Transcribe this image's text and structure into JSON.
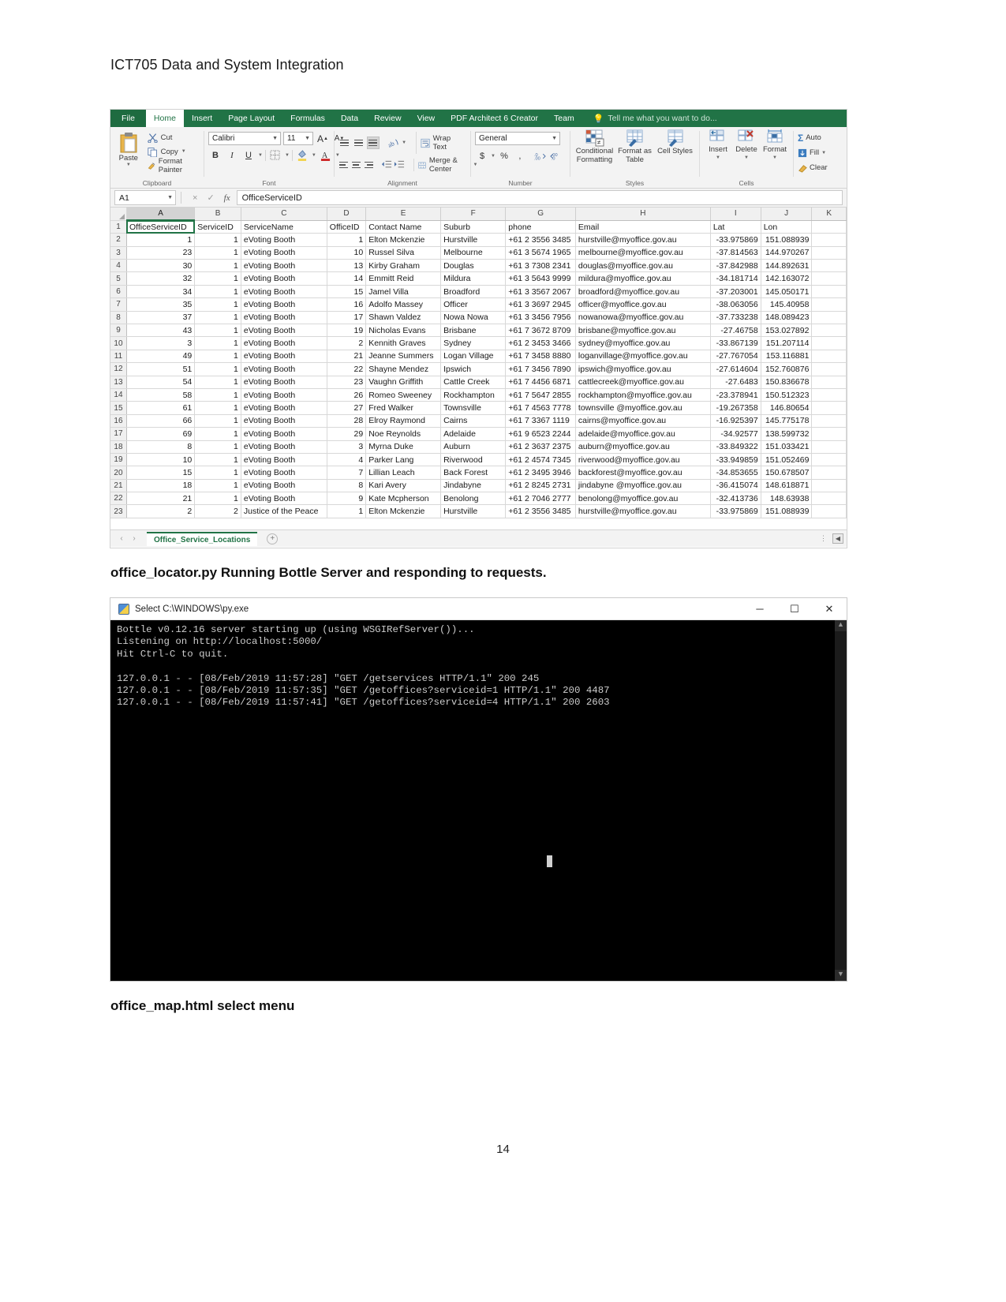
{
  "document": {
    "title": "ICT705 Data and System Integration",
    "page_number": "14",
    "caption_1": "office_locator.py Running Bottle Server and responding to requests.",
    "caption_2": "office_map.html select menu"
  },
  "excel": {
    "tabs": [
      {
        "label": "File",
        "state": "file"
      },
      {
        "label": "Home",
        "state": "active"
      },
      {
        "label": "Insert",
        "state": "normal"
      },
      {
        "label": "Page Layout",
        "state": "normal"
      },
      {
        "label": "Formulas",
        "state": "normal"
      },
      {
        "label": "Data",
        "state": "normal"
      },
      {
        "label": "Review",
        "state": "normal"
      },
      {
        "label": "View",
        "state": "normal"
      },
      {
        "label": "PDF Architect 6 Creator",
        "state": "normal"
      },
      {
        "label": "Team",
        "state": "normal"
      }
    ],
    "tell_me": "Tell me what you want to do...",
    "ribbon": {
      "clipboard": {
        "group_label": "Clipboard",
        "paste": "Paste",
        "cut": "Cut",
        "copy": "Copy",
        "format_painter": "Format Painter"
      },
      "font": {
        "group_label": "Font",
        "font_name": "Calibri",
        "font_size": "11",
        "grow_font": "A",
        "shrink_font": "A",
        "bold": "B",
        "italic": "I",
        "underline": "U"
      },
      "alignment": {
        "group_label": "Alignment",
        "wrap_text": "Wrap Text",
        "merge_center": "Merge & Center"
      },
      "number": {
        "group_label": "Number",
        "format": "General",
        "currency": "$",
        "percent": "%",
        "comma": ","
      },
      "styles": {
        "group_label": "Styles",
        "conditional_formatting": "Conditional Formatting",
        "format_as_table": "Format as Table",
        "cell_styles": "Cell Styles"
      },
      "cells": {
        "group_label": "Cells",
        "insert": "Insert",
        "delete": "Delete",
        "format": "Format"
      },
      "editing": {
        "autosum": "Auto",
        "fill": "Fill",
        "clear": "Clear"
      }
    },
    "formula_bar": {
      "name_box": "A1",
      "cancel": "×",
      "confirm": "✓",
      "fx": "fx",
      "value": "OfficeServiceID"
    },
    "grid": {
      "column_letters": [
        "A",
        "B",
        "C",
        "D",
        "E",
        "F",
        "G",
        "H",
        "I",
        "J",
        "K"
      ],
      "row_numbers": [
        "1",
        "2",
        "3",
        "4",
        "5",
        "6",
        "7",
        "8",
        "9",
        "10",
        "11",
        "12",
        "13",
        "14",
        "15",
        "16",
        "17",
        "18",
        "19",
        "20",
        "21",
        "22",
        "23"
      ],
      "headers": [
        "OfficeServiceID",
        "ServiceID",
        "ServiceName",
        "OfficeID",
        "Contact Name",
        "Suburb",
        "phone",
        "Email",
        "Lat",
        "Lon",
        ""
      ],
      "rows": [
        [
          "1",
          "1",
          "eVoting Booth",
          "1",
          "Elton Mckenzie",
          "Hurstville",
          "+61 2 3556 3485",
          "hurstville@myoffice.gov.au",
          "-33.975869",
          "151.088939",
          ""
        ],
        [
          "23",
          "1",
          "eVoting Booth",
          "10",
          "Russel Silva",
          "Melbourne",
          "+61 3 5674 1965",
          "melbourne@myoffice.gov.au",
          "-37.814563",
          "144.970267",
          ""
        ],
        [
          "30",
          "1",
          "eVoting Booth",
          "13",
          "Kirby Graham",
          "Douglas",
          "+61 3 7308 2341",
          "douglas@myoffice.gov.au",
          "-37.842988",
          "144.892631",
          ""
        ],
        [
          "32",
          "1",
          "eVoting Booth",
          "14",
          "Emmitt Reid",
          "Mildura",
          "+61 3 5643 9999",
          "mildura@myoffice.gov.au",
          "-34.181714",
          "142.163072",
          ""
        ],
        [
          "34",
          "1",
          "eVoting Booth",
          "15",
          "Jamel Villa",
          "Broadford",
          "+61 3 3567 2067",
          "broadford@myoffice.gov.au",
          "-37.203001",
          "145.050171",
          ""
        ],
        [
          "35",
          "1",
          "eVoting Booth",
          "16",
          "Adolfo Massey",
          "Officer",
          "+61 3 3697 2945",
          "officer@myoffice.gov.au",
          "-38.063056",
          "145.40958",
          ""
        ],
        [
          "37",
          "1",
          "eVoting Booth",
          "17",
          "Shawn Valdez",
          "Nowa Nowa",
          "+61 3 3456 7956",
          "nowanowa@myoffice.gov.au",
          "-37.733238",
          "148.089423",
          ""
        ],
        [
          "43",
          "1",
          "eVoting Booth",
          "19",
          "Nicholas Evans",
          "Brisbane",
          "+61 7 3672 8709",
          "brisbane@myoffice.gov.au",
          "-27.46758",
          "153.027892",
          ""
        ],
        [
          "3",
          "1",
          "eVoting Booth",
          "2",
          "Kennith Graves",
          "Sydney",
          "+61 2 3453 3466",
          "sydney@myoffice.gov.au",
          "-33.867139",
          "151.207114",
          ""
        ],
        [
          "49",
          "1",
          "eVoting Booth",
          "21",
          "Jeanne Summers",
          "Logan Village",
          "+61 7 3458 8880",
          "loganvillage@myoffice.gov.au",
          "-27.767054",
          "153.116881",
          ""
        ],
        [
          "51",
          "1",
          "eVoting Booth",
          "22",
          "Shayne Mendez",
          "Ipswich",
          "+61 7 3456 7890",
          "ipswich@myoffice.gov.au",
          "-27.614604",
          "152.760876",
          ""
        ],
        [
          "54",
          "1",
          "eVoting Booth",
          "23",
          "Vaughn Griffith",
          "Cattle Creek",
          "+61 7 4456 6871",
          "cattlecreek@myoffice.gov.au",
          "-27.6483",
          "150.836678",
          ""
        ],
        [
          "58",
          "1",
          "eVoting Booth",
          "26",
          "Romeo Sweeney",
          "Rockhampton",
          "+61 7 5647 2855",
          "rockhampton@myoffice.gov.au",
          "-23.378941",
          "150.512323",
          ""
        ],
        [
          "61",
          "1",
          "eVoting Booth",
          "27",
          "Fred Walker",
          "Townsville",
          "+61 7 4563 7778",
          "townsville @myoffice.gov.au",
          "-19.267358",
          "146.80654",
          ""
        ],
        [
          "66",
          "1",
          "eVoting Booth",
          "28",
          "Elroy Raymond",
          "Cairns",
          "+61 7 3367 1119",
          "cairns@myoffice.gov.au",
          "-16.925397",
          "145.775178",
          ""
        ],
        [
          "69",
          "1",
          "eVoting Booth",
          "29",
          "Noe Reynolds",
          "Adelaide",
          "+61 9 6523 2244",
          "adelaide@myoffice.gov.au",
          "-34.92577",
          "138.599732",
          ""
        ],
        [
          "8",
          "1",
          "eVoting Booth",
          "3",
          "Myrna Duke",
          "Auburn",
          "+61 2 3637 2375",
          "auburn@myoffice.gov.au",
          "-33.849322",
          "151.033421",
          ""
        ],
        [
          "10",
          "1",
          "eVoting Booth",
          "4",
          "Parker Lang",
          "Riverwood",
          "+61 2 4574 7345",
          "riverwood@myoffice.gov.au",
          "-33.949859",
          "151.052469",
          ""
        ],
        [
          "15",
          "1",
          "eVoting Booth",
          "7",
          "Lillian Leach",
          "Back Forest",
          "+61 2 3495 3946",
          "backforest@myoffice.gov.au",
          "-34.853655",
          "150.678507",
          ""
        ],
        [
          "18",
          "1",
          "eVoting Booth",
          "8",
          "Kari Avery",
          "Jindabyne",
          "+61 2 8245 2731",
          "jindabyne @myoffice.gov.au",
          "-36.415074",
          "148.618871",
          ""
        ],
        [
          "21",
          "1",
          "eVoting Booth",
          "9",
          "Kate Mcpherson",
          "Benolong",
          "+61 2 7046 2777",
          "benolong@myoffice.gov.au",
          "-32.413736",
          "148.63938",
          ""
        ],
        [
          "2",
          "2",
          "Justice of the Peace",
          "1",
          "Elton Mckenzie",
          "Hurstville",
          "+61 2 3556 3485",
          "hurstville@myoffice.gov.au",
          "-33.975869",
          "151.088939",
          ""
        ]
      ]
    },
    "sheet_bar": {
      "prev": "‹",
      "next": "›",
      "sheet_name": "Office_Service_Locations",
      "add_sheet": "+"
    }
  },
  "console": {
    "title": "Select C:\\WINDOWS\\py.exe",
    "minimize": "─",
    "maximize": "☐",
    "close": "✕",
    "lines": "Bottle v0.12.16 server starting up (using WSGIRefServer())...\nListening on http://localhost:5000/\nHit Ctrl-C to quit.\n\n127.0.0.1 - - [08/Feb/2019 11:57:28] \"GET /getservices HTTP/1.1\" 200 245\n127.0.0.1 - - [08/Feb/2019 11:57:35] \"GET /getoffices?serviceid=1 HTTP/1.1\" 200 4487\n127.0.0.1 - - [08/Feb/2019 11:57:41] \"GET /getoffices?serviceid=4 HTTP/1.1\" 200 2603",
    "scroll_up": "▲",
    "scroll_down": "▼"
  },
  "colors": {
    "excel_green": "#217346",
    "console_bg": "#000000",
    "console_fg": "#cccccc"
  }
}
